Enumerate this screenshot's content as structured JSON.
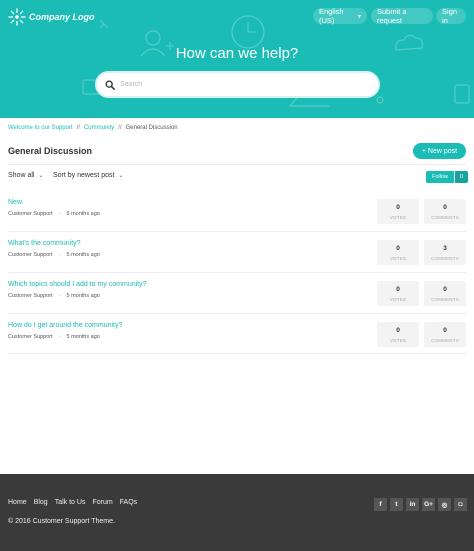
{
  "header": {
    "logo_text": "Company Logo",
    "language": "English (US)",
    "submit_request": "Submit a request",
    "sign_in": "Sign in",
    "hero_title": "How can we help?",
    "search_placeholder": "Search"
  },
  "breadcrumb": {
    "items": [
      "Welcome to our Support",
      "Community",
      "General Discussion"
    ],
    "separator": "//"
  },
  "page": {
    "title": "General Discussion",
    "new_post_label": "+ New post",
    "filter_show": "Show all",
    "filter_sort": "Sort by newest post",
    "follow_label": "Follow",
    "follow_count": "0"
  },
  "posts": [
    {
      "title": "New",
      "author": "Customer Support",
      "time": "5 months ago",
      "votes": "0",
      "comments": "0"
    },
    {
      "title": "What's the community?",
      "author": "Customer Support",
      "time": "5 months ago",
      "votes": "0",
      "comments": "3"
    },
    {
      "title": "Which topics should I add to my community?",
      "author": "Customer Support",
      "time": "5 months ago",
      "votes": "0",
      "comments": "0"
    },
    {
      "title": "How do I get around the community?",
      "author": "Customer Support",
      "time": "5 months ago",
      "votes": "0",
      "comments": "0"
    }
  ],
  "stat_labels": {
    "votes": "VOTES",
    "comments": "COMMENTS"
  },
  "meta_separator": "-",
  "footer": {
    "links": [
      "Home",
      "Blog",
      "Talk to Us",
      "Forum",
      "FAQs"
    ],
    "copyright": "© 2016 Customer Support Theme.",
    "social": [
      {
        "icon": "facebook-icon",
        "glyph": "f"
      },
      {
        "icon": "twitter-icon",
        "glyph": "t"
      },
      {
        "icon": "linkedin-icon",
        "glyph": "in"
      },
      {
        "icon": "google-plus-icon",
        "glyph": "G+"
      },
      {
        "icon": "github-icon",
        "glyph": "◎"
      },
      {
        "icon": "instagram-icon",
        "glyph": "◘"
      }
    ]
  },
  "colors": {
    "accent": "#1bbcb6",
    "footer_bg": "#3a3a3a"
  }
}
